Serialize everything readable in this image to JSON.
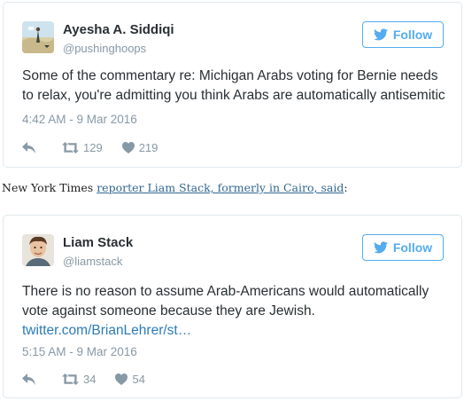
{
  "tweets": [
    {
      "name": "Ayesha A. Siddiqi",
      "handle": "@pushinghoops",
      "follow_label": "Follow",
      "text_line1": "Some of the commentary re: Michigan Arabs voting for Bernie needs",
      "text_line2": "to relax, you're admitting you think Arabs are automatically antisemitic",
      "link": "",
      "time": "4:42 AM - 9 Mar 2016",
      "retweets": "129",
      "likes": "219"
    },
    {
      "name": "Liam Stack",
      "handle": "@liamstack",
      "follow_label": "Follow",
      "text_line1": "There is no reason to assume Arab-Americans would automatically",
      "text_line2": "vote against someone because they are Jewish.",
      "link": "twitter.com/BrianLehrer/st…",
      "time": "5:15 AM - 9 Mar 2016",
      "retweets": "34",
      "likes": "54"
    }
  ],
  "between": {
    "prefix": "New York Times ",
    "link_text": "reporter Liam Stack, formerly in Cairo, said",
    "suffix": ":"
  },
  "colors": {
    "twitter_blue": "#55acee",
    "link_blue": "#2b7bb9",
    "muted_gray": "#8899a6",
    "nyt_link": "#326891"
  },
  "icons": [
    "twitter-bird-icon",
    "reply-icon",
    "retweet-icon",
    "heart-icon"
  ]
}
